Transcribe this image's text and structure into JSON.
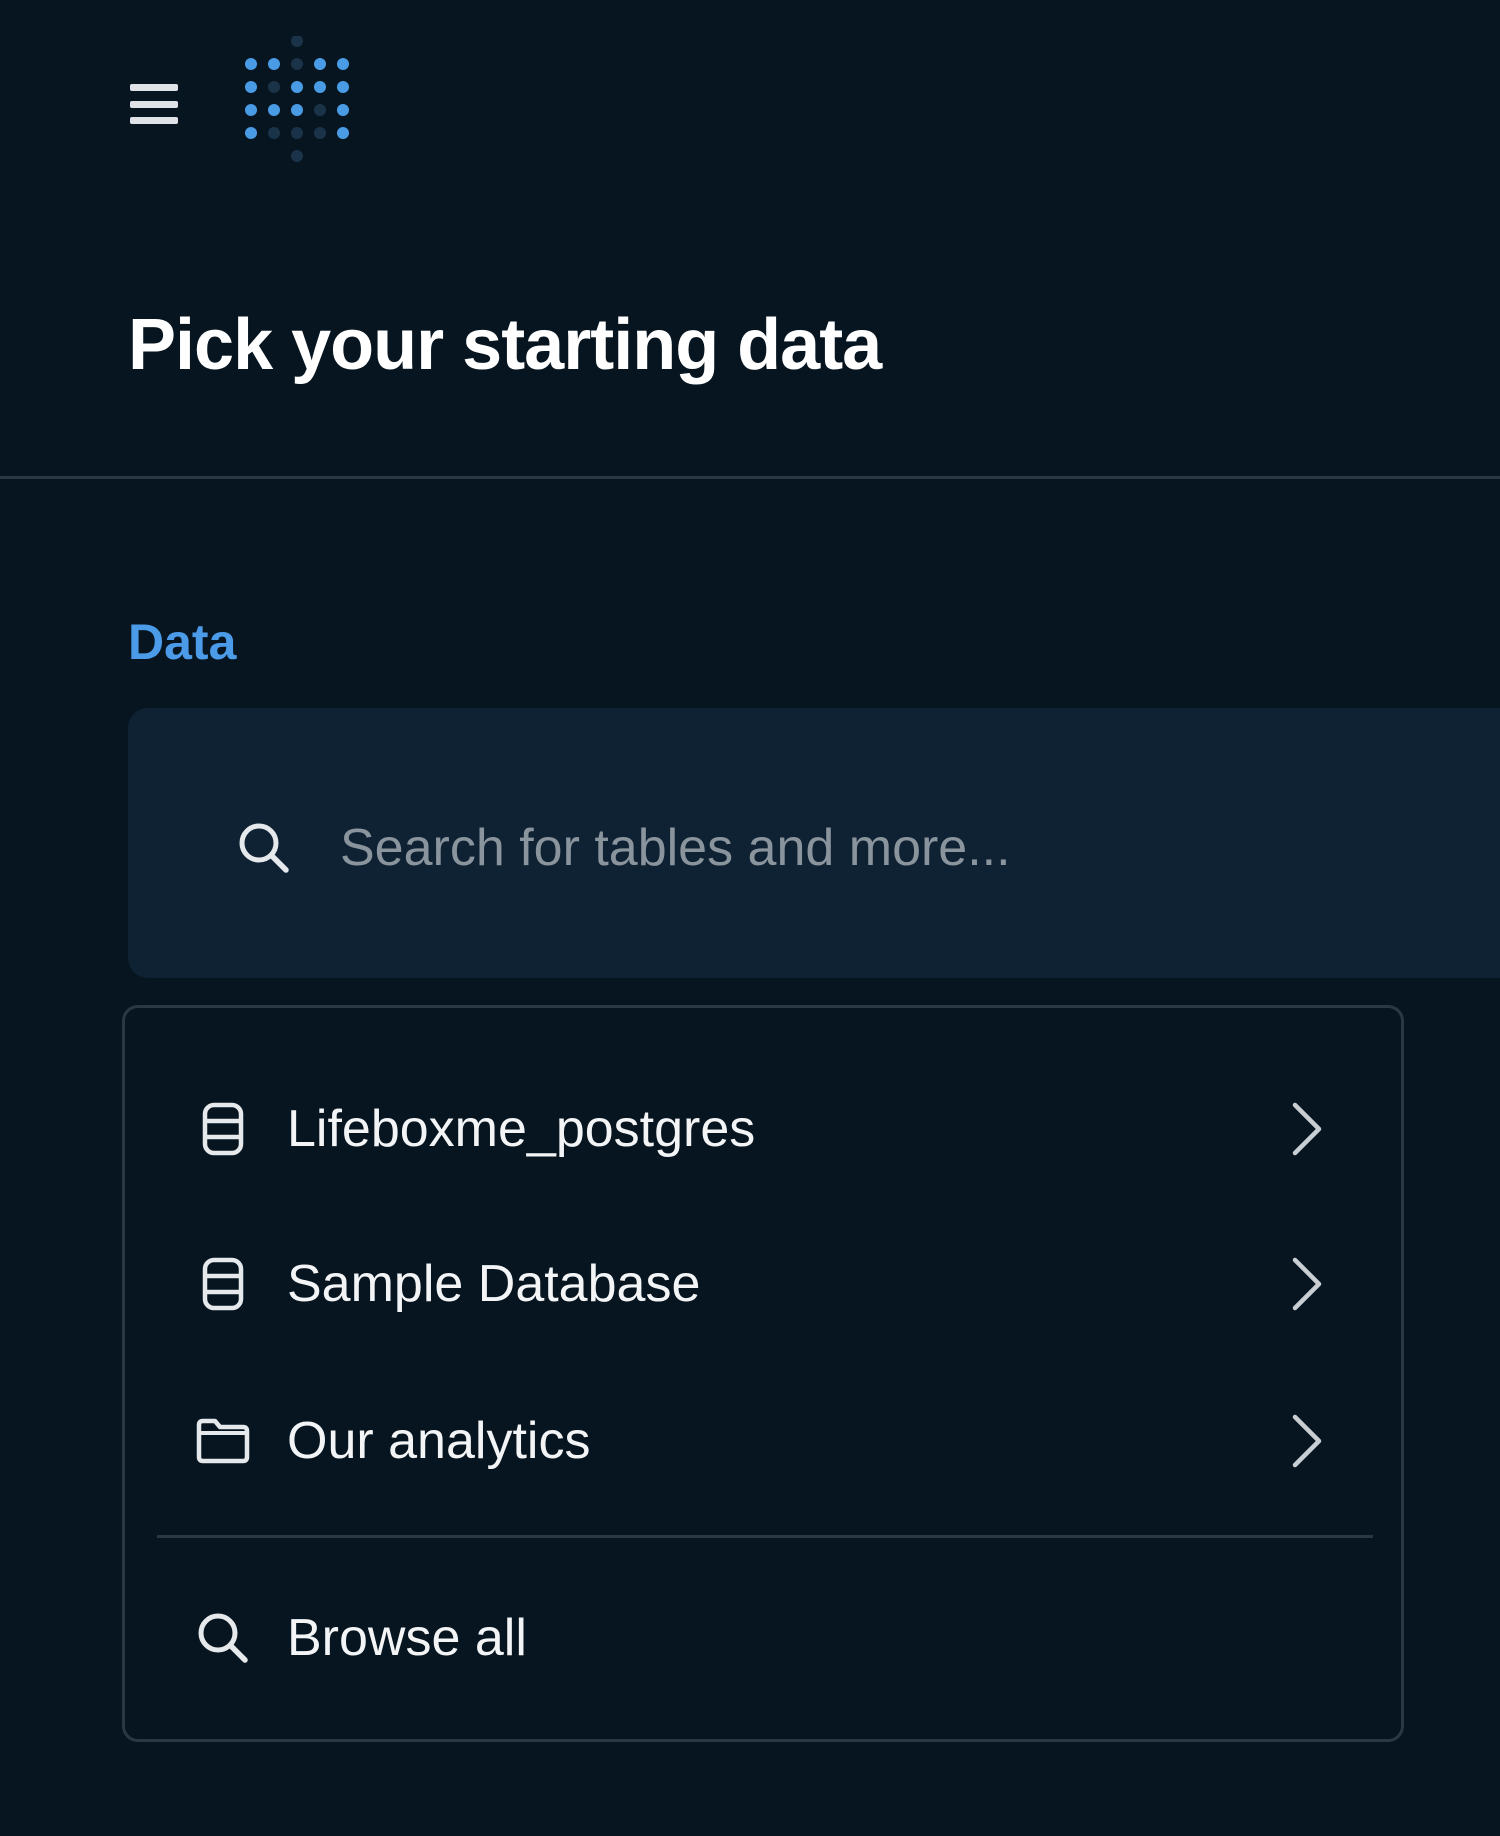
{
  "header": {
    "menu_icon": "hamburger-menu-icon",
    "logo_icon": "metabase-logo-icon"
  },
  "page": {
    "title": "Pick your starting data"
  },
  "data_section": {
    "label": "Data",
    "search": {
      "placeholder": "Search for tables and more...",
      "value": "",
      "icon": "search-icon"
    },
    "items": [
      {
        "label": "Lifeboxme_postgres",
        "icon": "database-icon",
        "trailing_icon": "chevron-right-icon"
      },
      {
        "label": "Sample Database",
        "icon": "database-icon",
        "trailing_icon": "chevron-right-icon"
      },
      {
        "label": "Our analytics",
        "icon": "folder-icon",
        "trailing_icon": "chevron-right-icon"
      }
    ],
    "browse_all": {
      "label": "Browse all",
      "icon": "search-icon"
    }
  },
  "colors": {
    "background": "#071520",
    "accent": "#4b9be8",
    "search_background": "#0f2233",
    "border": "#2b3742"
  }
}
